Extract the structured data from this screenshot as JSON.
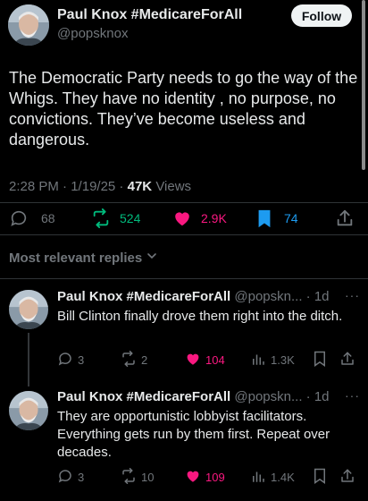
{
  "tweet": {
    "author_name": "Paul Knox #MedicareForAll",
    "author_handle": "@popsknox",
    "follow_label": "Follow",
    "text": "The Democratic Party needs to go the way of the Whigs. They have no identity , no purpose, no convictions. They’ve become useless and dangerous.",
    "time": "2:28 PM",
    "date": "1/19/25",
    "views_count": "47K",
    "views_label": "Views",
    "replies": "68",
    "reposts": "524",
    "likes": "2.9K",
    "bookmarks": "74"
  },
  "replies_section": {
    "sort_label": "Most relevant replies"
  },
  "replies": [
    {
      "author_name": "Paul Knox #MedicareForAll",
      "author_handle": "@popskn...",
      "age": "1d",
      "text": "Bill Clinton finally drove them right into the ditch.",
      "replies": "3",
      "reposts": "2",
      "likes": "104",
      "views": "1.3K"
    },
    {
      "author_name": "Paul Knox #MedicareForAll",
      "author_handle": "@popskn...",
      "age": "1d",
      "text": "They are opportunistic lobbyist facilitators. Everything gets run by them first. Repeat over decades.",
      "replies": "3",
      "reposts": "10",
      "likes": "109",
      "views": "1.4K"
    }
  ],
  "colors": {
    "background": "#000000",
    "text": "#e7e9ea",
    "muted": "#71767b",
    "repost_green": "#00ba7c",
    "like_pink": "#f91880",
    "bookmark_blue": "#1d9bf0"
  }
}
